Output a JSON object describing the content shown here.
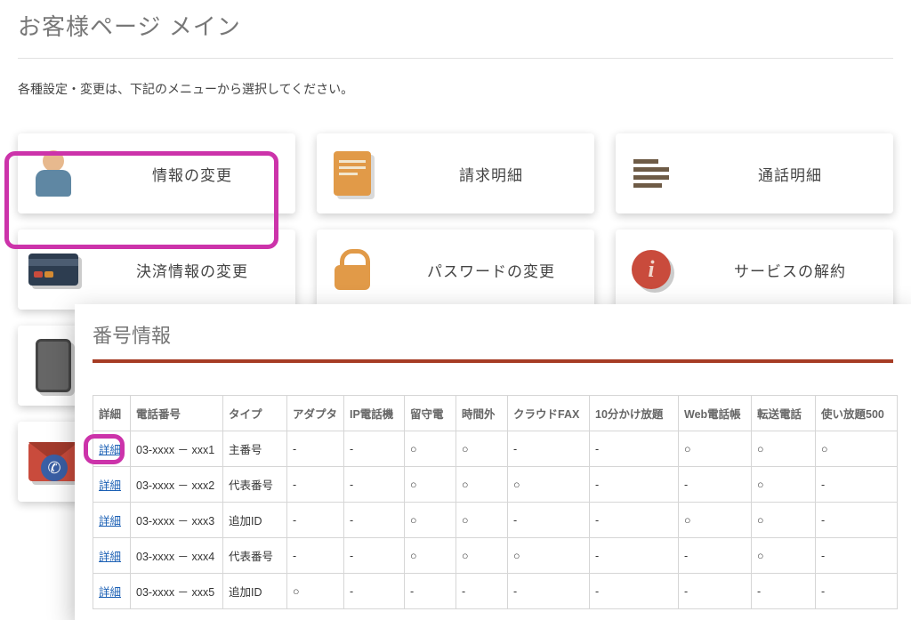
{
  "page": {
    "title": "お客様ページ メイン",
    "intro": "各種設定・変更は、下記のメニューから選択してください。"
  },
  "menu": [
    {
      "id": "info-change",
      "label": "情報の変更",
      "icon": "avatar-icon"
    },
    {
      "id": "billing",
      "label": "請求明細",
      "icon": "doc-icon"
    },
    {
      "id": "call-log",
      "label": "通話明細",
      "icon": "lines-icon"
    },
    {
      "id": "payment-change",
      "label": "決済情報の変更",
      "icon": "card-icon"
    },
    {
      "id": "password-change",
      "label": "パスワードの変更",
      "icon": "lock-icon"
    },
    {
      "id": "service-cancel",
      "label": "サービスの解約",
      "icon": "info-icon"
    },
    {
      "id": "device",
      "label": "",
      "icon": "phone-icon"
    },
    {
      "id": "mail",
      "label": "",
      "icon": "mail-icon"
    }
  ],
  "panel": {
    "title": "番号情報",
    "headers": [
      "詳細",
      "電話番号",
      "タイプ",
      "アダプタ",
      "IP電話機",
      "留守電",
      "時間外",
      "クラウドFAX",
      "10分かけ放題",
      "Web電話帳",
      "転送電話",
      "使い放題500"
    ],
    "detail_link_label": "詳細",
    "rows": [
      {
        "phone": "03-xxxx － xxx1",
        "type": "主番号",
        "cells": [
          "-",
          "-",
          "○",
          "○",
          "-",
          "-",
          "○",
          "○",
          "○"
        ]
      },
      {
        "phone": "03-xxxx － xxx2",
        "type": "代表番号",
        "cells": [
          "-",
          "-",
          "○",
          "○",
          "○",
          "-",
          "-",
          "○",
          "-"
        ]
      },
      {
        "phone": "03-xxxx － xxx3",
        "type": "追加ID",
        "cells": [
          "-",
          "-",
          "○",
          "○",
          "-",
          "-",
          "○",
          "○",
          "-"
        ]
      },
      {
        "phone": "03-xxxx － xxx4",
        "type": "代表番号",
        "cells": [
          "-",
          "-",
          "○",
          "○",
          "○",
          "-",
          "-",
          "○",
          "-"
        ]
      },
      {
        "phone": "03-xxxx － xxx5",
        "type": "追加ID",
        "cells": [
          "○",
          "-",
          "-",
          "-",
          "-",
          "-",
          "-",
          "-",
          "-"
        ]
      }
    ]
  }
}
